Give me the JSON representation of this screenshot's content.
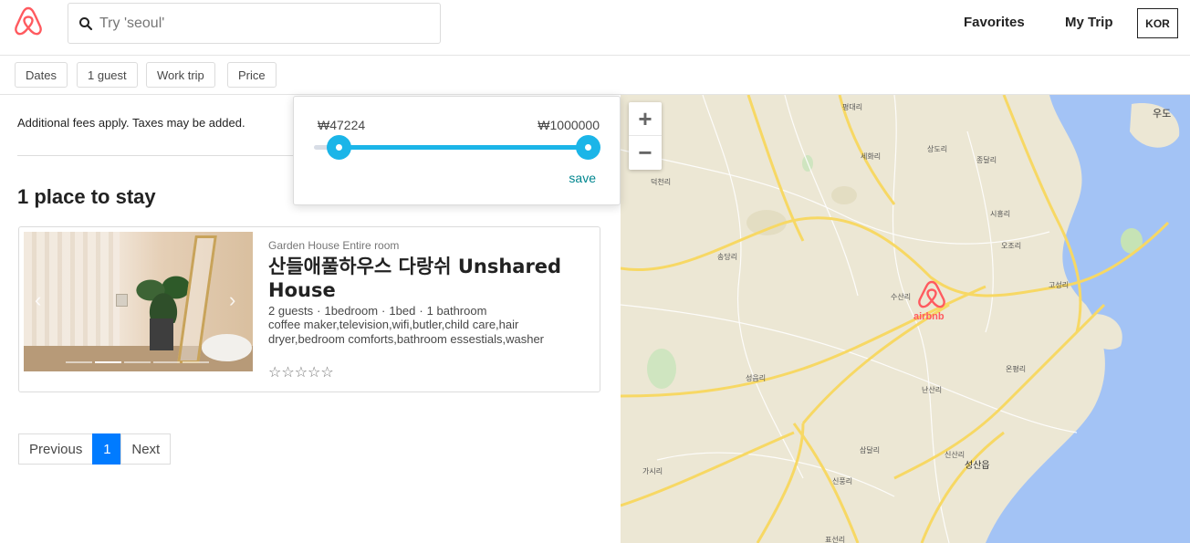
{
  "header": {
    "logo": "airbnb-logo",
    "search_placeholder": "Try 'seoul'",
    "nav": {
      "favorites": "Favorites",
      "my_trip": "My Trip",
      "language": "KOR"
    }
  },
  "filters": {
    "dates": "Dates",
    "guests": "1 guest",
    "work_trip": "Work trip",
    "price": "Price"
  },
  "results": {
    "fees_note": "Additional fees apply. Taxes may be added.",
    "title": "1 place to stay",
    "listings": [
      {
        "type": "Garden House Entire room",
        "title": "산들애풀하우스 다랑쉬 Unshared House",
        "guests": "2 guests",
        "bedrooms": "1bedroom",
        "beds": "1bed",
        "baths": "1 bathroom",
        "amenities": "coffee maker,television,wifi,butler,child care,hair dryer,bedroom comforts,bathroom essestials,washer",
        "stars": "☆☆☆☆☆",
        "photo_index": 2,
        "photo_count": 5
      }
    ]
  },
  "pager": {
    "previous": "Previous",
    "current": "1",
    "next": "Next"
  },
  "price_filter": {
    "min_label": "₩47224",
    "max_label": "₩1000000",
    "save": "save",
    "min_value": 47224,
    "max_value": 1000000
  },
  "map": {
    "zoom_in": "+",
    "zoom_out": "−",
    "marker_label": "airbnb",
    "labels": [
      "우도",
      "평대리",
      "세화리",
      "상도리",
      "종달리",
      "덕천리",
      "송당리",
      "시흥리",
      "오조리",
      "수산리",
      "고성리",
      "성읍리",
      "온평리",
      "난산리",
      "신산리",
      "삼달리",
      "성산읍",
      "가시리",
      "신풍리",
      "표선리"
    ]
  },
  "colors": {
    "brand": "#ff5a5f",
    "slider": "#1bb5e8",
    "active_page": "#007bff",
    "save": "#00868f",
    "water": "#a3c3f5",
    "road": "#f7d864"
  }
}
